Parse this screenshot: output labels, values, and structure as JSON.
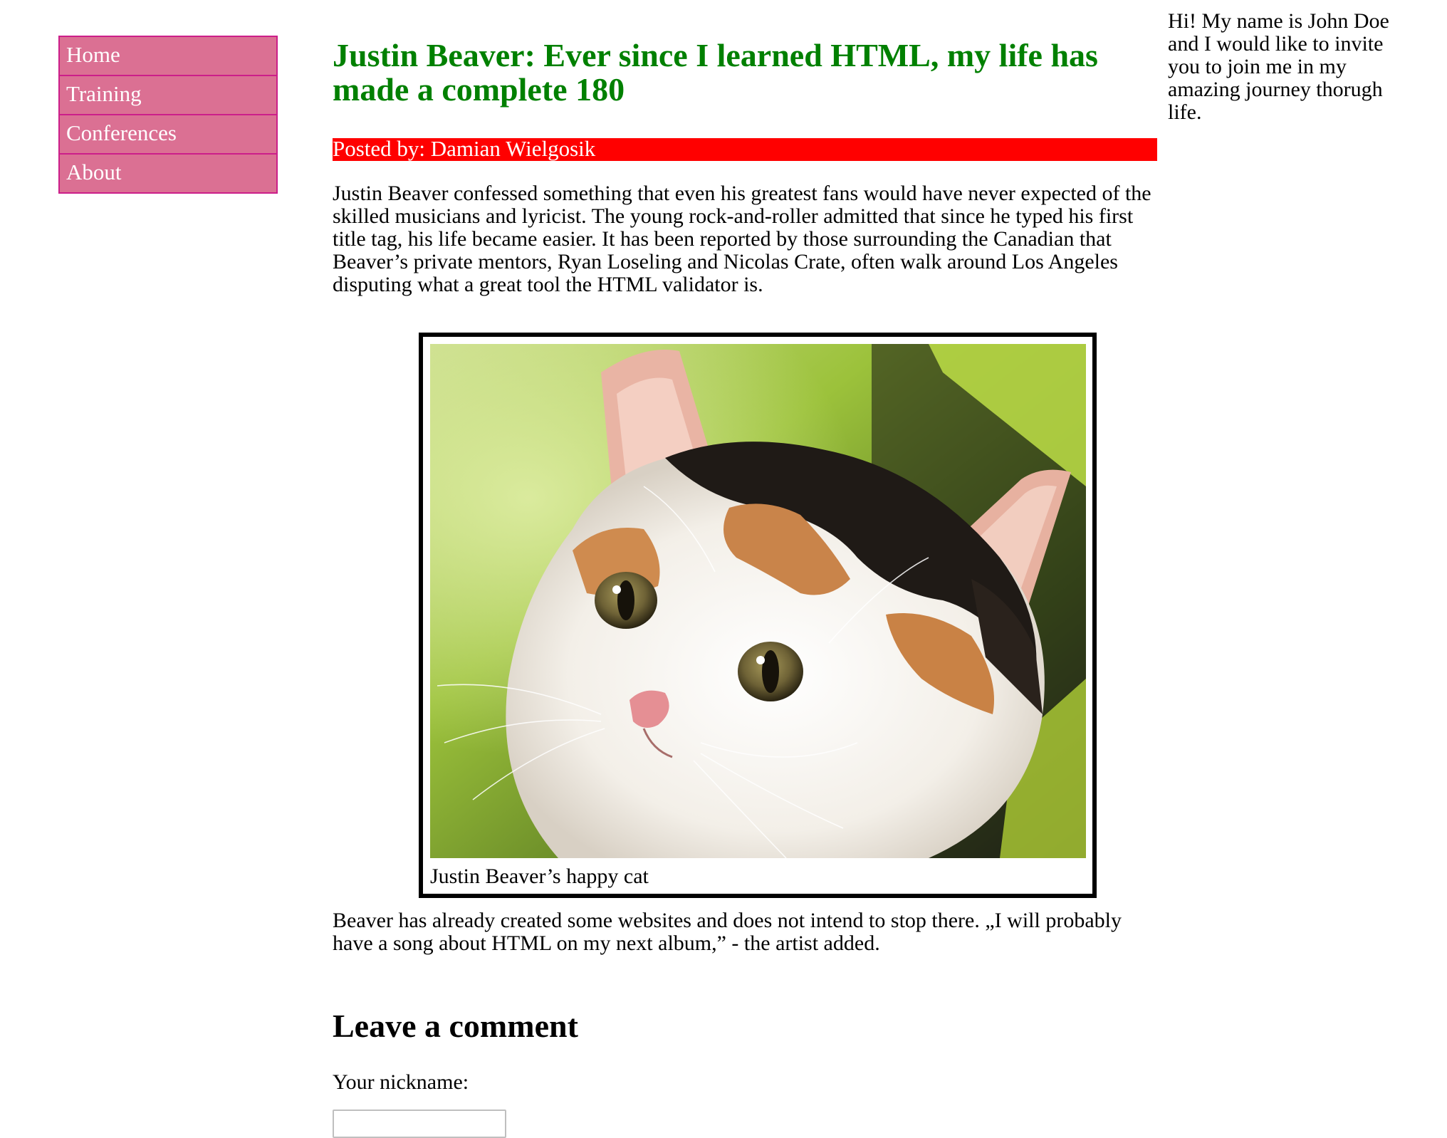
{
  "nav": {
    "items": [
      {
        "label": "Home"
      },
      {
        "label": "Training"
      },
      {
        "label": "Conferences"
      },
      {
        "label": "About"
      }
    ],
    "colors": {
      "background": "#db7093",
      "border": "#cc1e8a",
      "text": "#ffffff"
    }
  },
  "article": {
    "title": "Justin Beaver: Ever since I learned HTML, my life has made a complete 180",
    "title_color": "#008000",
    "posted_by": "Posted by: Damian Wielgosik",
    "posted_bg": "#ff0000",
    "paragraph1": "Justin Beaver confessed something that even his greatest fans would have never expected of the skilled musicians and lyricist. The young rock-and-roller admitted that since he typed his first title tag, his life became easier. It has been reported by those surrounding the Canadian that Beaver’s private mentors, Ryan Loseling and Nicolas Crate, often walk around Los Angeles disputing what a great tool the HTML validator is.",
    "figure_caption": "Justin Beaver’s happy cat",
    "paragraph2": "Beaver has already created some websites and does not intend to stop there. „I will probably have a song about HTML on my next album,” - the artist added."
  },
  "comment_form": {
    "heading": "Leave a comment",
    "nickname_label": "Your nickname:",
    "nickname_value": ""
  },
  "aside": {
    "text": "Hi! My name is John Doe and I would like to invite you to join me in my amazing journey thorugh life."
  }
}
